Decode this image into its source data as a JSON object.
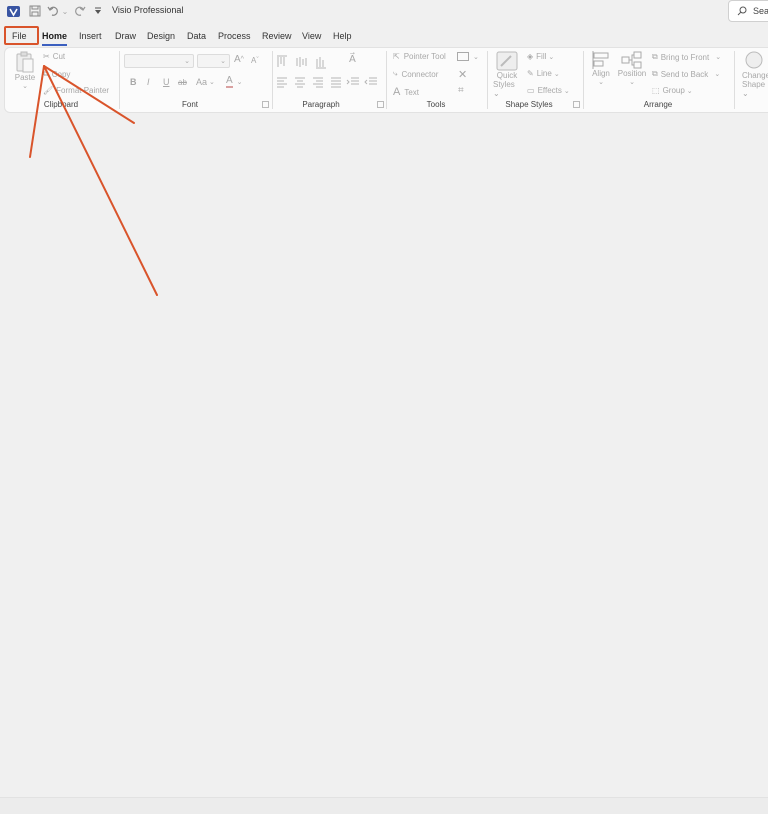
{
  "titlebar": {
    "app_title": "Visio Professional",
    "search_placeholder": "Sea"
  },
  "tabs": [
    "File",
    "Home",
    "Insert",
    "Draw",
    "Design",
    "Data",
    "Process",
    "Review",
    "View",
    "Help"
  ],
  "active_tab": "Home",
  "ribbon": {
    "clipboard": {
      "paste": "Paste",
      "cut": "Cut",
      "copy": "Copy",
      "format_painter": "Format Painter",
      "label": "Clipboard"
    },
    "font": {
      "bold": "B",
      "italic": "I",
      "underline": "U",
      "strike": "ab",
      "case": "Aa",
      "grow": "A",
      "shrink": "A",
      "color": "A",
      "label": "Font"
    },
    "paragraph": {
      "label": "Paragraph"
    },
    "tools": {
      "pointer": "Pointer Tool",
      "connector": "Connector",
      "text": "Text",
      "label": "Tools"
    },
    "shape_styles": {
      "quick1": "Quick",
      "quick2": "Styles",
      "fill": "Fill",
      "line": "Line",
      "effects": "Effects",
      "label": "Shape Styles"
    },
    "arrange": {
      "align": "Align",
      "position": "Position",
      "bring_front": "Bring to Front",
      "send_back": "Send to Back",
      "group": "Group",
      "label": "Arrange"
    },
    "change_shape": {
      "line1": "Change",
      "line2": "Shape"
    }
  },
  "colors": {
    "accent": "#3b5fbf",
    "annotation": "#d9542b",
    "visio_blue": "#3955a3"
  }
}
